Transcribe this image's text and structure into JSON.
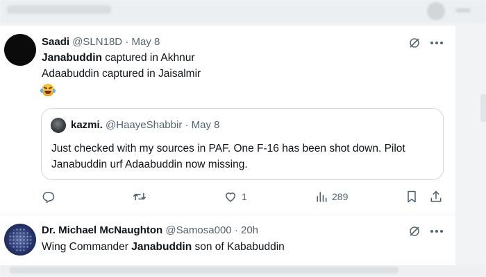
{
  "colors": {
    "text": "#0f1419",
    "muted": "#536471",
    "border": "#cfd9de"
  },
  "tweet1": {
    "name": "Saadi",
    "handle": "@SLN18D",
    "dot": "·",
    "time": "May 8",
    "line1_bold": "Janabuddin",
    "line1_rest": " captured in Akhnur",
    "line2": "Adaabuddin captured in Jaisalmir",
    "emoji": "face-with-tears-of-joy",
    "quote": {
      "name": "kazmi.",
      "handle": "@HaayeShabbir",
      "dot": "·",
      "time": "May 8",
      "text": "Just checked with my sources in PAF. One F-16 has been shot down. Pilot Janabuddin urf Adaabuddin now missing."
    },
    "actions": {
      "reply_count": "",
      "retweet_count": "",
      "like_count": "1",
      "views_count": "289"
    }
  },
  "tweet2": {
    "name": "Dr. Michael McNaughton",
    "handle": "@Samosa000",
    "dot": "·",
    "time": "20h",
    "text_pre": "Wing Commander ",
    "text_bold": "Janabuddin",
    "text_post": " son of Kababuddin"
  }
}
